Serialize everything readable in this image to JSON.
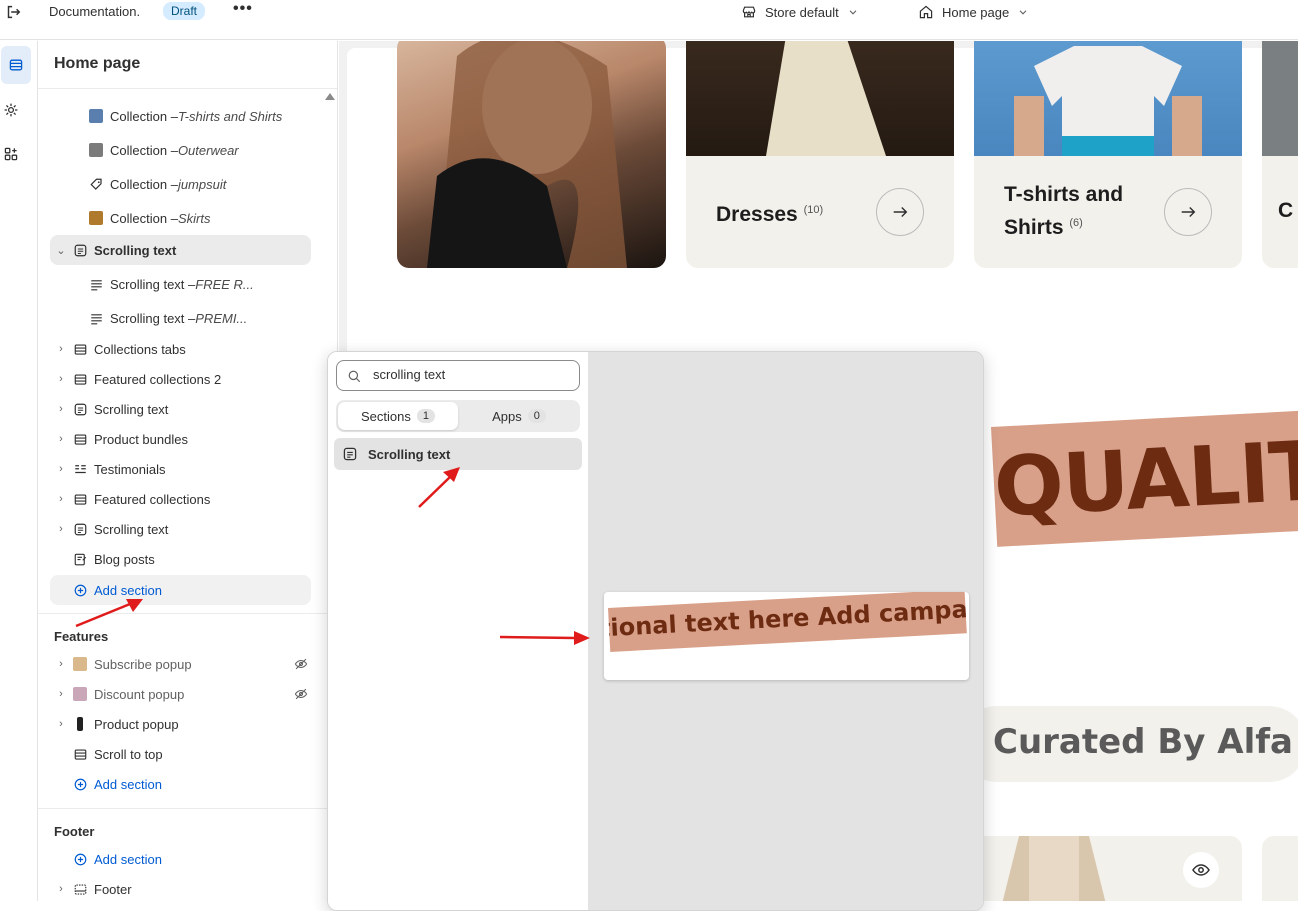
{
  "topbar": {
    "store_name": "Documentation.",
    "status_badge": "Draft",
    "more": "•••",
    "store_context": "Store default",
    "page_context": "Home page"
  },
  "panel": {
    "title": "Home page",
    "template_items": [
      {
        "label": "Collection – ",
        "sub": "T-shirts and Shirts"
      },
      {
        "label": "Collection – ",
        "sub": "Outerwear"
      },
      {
        "label": "Collection – ",
        "sub": "jumpsuit"
      },
      {
        "label": "Collection – ",
        "sub": "Skirts"
      }
    ],
    "scrolling_text_selected": "Scrolling text",
    "scrolling_children": [
      {
        "label": "Scrolling text – ",
        "sub": "FREE R..."
      },
      {
        "label": "Scrolling text – ",
        "sub": "PREMI..."
      }
    ],
    "sections": [
      "Collections tabs",
      "Featured collections 2",
      "Scrolling text",
      "Product bundles",
      "Testimonials",
      "Featured collections",
      "Scrolling text",
      "Blog posts"
    ],
    "add_section": "Add section",
    "features_header": "Features",
    "features": [
      "Subscribe popup",
      "Discount popup",
      "Product popup",
      "Scroll to top"
    ],
    "features_add": "Add section",
    "footer_header": "Footer",
    "footer_add": "Add section",
    "footer_item": "Footer"
  },
  "popup": {
    "search_value": "scrolling text",
    "tab_sections": "Sections",
    "tab_sections_count": "1",
    "tab_apps": "Apps",
    "tab_apps_count": "0",
    "result": "Scrolling text",
    "preview_text": "tional text here  Add campaig"
  },
  "preview": {
    "coll_1_name": "Dresses",
    "coll_1_count": "(10)",
    "coll_2_name_line1": "T-shirts and",
    "coll_2_name_line2": "Shirts",
    "coll_2_count": "(6)",
    "coll_3_partial": "C",
    "quality_text": "QUALITY",
    "curated_text": "Curated By Alfa"
  },
  "colors": {
    "accent": "#005bd3",
    "band": "#d9a089",
    "band_text": "#6d2b12",
    "arrow": "#e01b1b"
  }
}
